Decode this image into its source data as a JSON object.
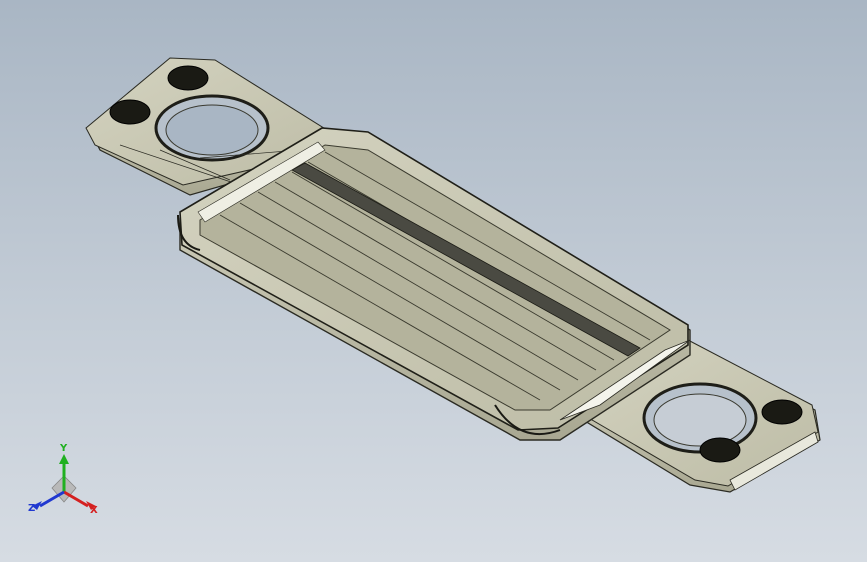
{
  "viewport": {
    "model": "plate-heat-exchanger-gasket-plate",
    "background_top": "#a9b6c4",
    "background_bottom": "#d6dce3",
    "shading": "shaded-with-edges",
    "model_color": "#c9c8b4",
    "edge_color": "#2a2a22"
  },
  "triad": {
    "y_label": "Y",
    "z_label": "Z",
    "x_label": "X",
    "colors": {
      "x": "#d42020",
      "y": "#20b020",
      "z": "#2038d0"
    }
  }
}
